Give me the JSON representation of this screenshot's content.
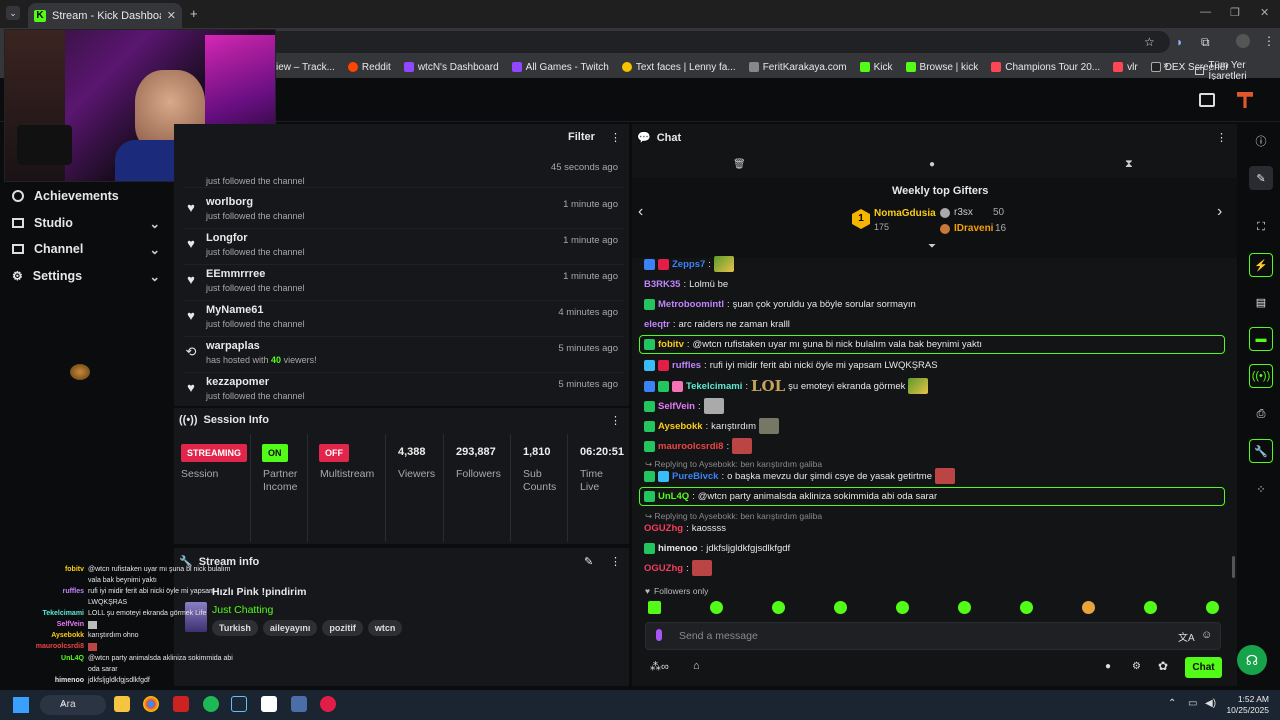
{
  "browser": {
    "tab_title": "Stream - Kick Dashboard",
    "bookmarks": [
      "iew – Track...",
      "Reddit",
      "wtcN's Dashboard",
      "All Games - Twitch",
      "Text faces | Lenny fa...",
      "FeritKarakaya.com",
      "Kick",
      "Browse | kick",
      "Champions Tour 20...",
      "vlr",
      "DEX Screener"
    ],
    "bookmarks_folder": "Tüm Yer İşaretleri"
  },
  "sidebar": {
    "items": [
      {
        "label": "Achievements"
      },
      {
        "label": "Studio"
      },
      {
        "label": "Channel"
      },
      {
        "label": "Settings"
      }
    ]
  },
  "activity": {
    "filter_label": "Filter",
    "rows": [
      {
        "name": "",
        "sub": "just followed the channel",
        "time": "45 seconds ago"
      },
      {
        "name": "worlborg",
        "sub": "just followed the channel",
        "time": "1 minute ago"
      },
      {
        "name": "Longfor",
        "sub": "just followed the channel",
        "time": "1 minute ago"
      },
      {
        "name": "EEmmrrree",
        "sub": "just followed the channel",
        "time": "1 minute ago"
      },
      {
        "name": "MyName61",
        "sub": "just followed the channel",
        "time": "4 minutes ago"
      },
      {
        "name": "warpaplas",
        "sub_prefix": "has hosted with ",
        "viewers": "40",
        "sub_suffix": " viewers!",
        "time": "5 minutes ago"
      },
      {
        "name": "kezzapomer",
        "sub": "just followed the channel",
        "time": "5 minutes ago"
      }
    ]
  },
  "session": {
    "title": "Session Info",
    "streaming_badge": "STREAMING",
    "on_badge": "ON",
    "off_badge": "OFF",
    "session_label": "Session",
    "partner_label": "Partner Income",
    "multistream_label": "Multistream",
    "viewers": "4,388",
    "viewers_label": "Viewers",
    "followers": "293,887",
    "followers_label": "Followers",
    "subs": "1,810",
    "subs_label": "Sub Counts",
    "time": "06:20:51",
    "time_label": "Time Live"
  },
  "stream_info": {
    "title": "Stream info",
    "stream_title": "Hızlı Pink !pindirim",
    "category": "Just Chatting",
    "tags": [
      "Turkish",
      "aileyayını",
      "pozitif",
      "wtcn"
    ]
  },
  "chat": {
    "title": "Chat",
    "gifters_title": "Weekly top Gifters",
    "gifters": [
      {
        "rank": "1",
        "name": "NomaGdusia",
        "amount": "175"
      },
      {
        "rank": "2",
        "name": "r3sx",
        "amount": "50"
      },
      {
        "rank": "3",
        "name": "IDraveni",
        "amount": "16"
      }
    ],
    "messages": [
      {
        "user": "Zepps7",
        "color": "#3b82f6",
        "text": ""
      },
      {
        "user": "B3RK35",
        "color": "#c084fc",
        "text": "Lolmü be"
      },
      {
        "user": "Metroboomintl",
        "color": "#c084fc",
        "text": "şuan çok yoruldu ya böyle sorular sormayın"
      },
      {
        "user": "eleqtr",
        "color": "#c084fc",
        "text": "arc raiders ne zaman kralll"
      },
      {
        "user": "fobitv",
        "color": "#facc15",
        "text": "@wtcn rufistaken uyar mı şuna bi nick bulalım vala bak beynimi yaktı"
      },
      {
        "user": "ruffles",
        "color": "#c084fc",
        "text": "rufi iyi midir ferit abi nicki öyle mi yapsam LWQKŞRAS"
      },
      {
        "user": "Tekelcimami",
        "color": "#5eead4",
        "text": "şu emoteyi ekranda görmek",
        "emote_text": "LOL"
      },
      {
        "user": "SelfVein",
        "color": "#e879f9",
        "text": ""
      },
      {
        "user": "Aysebokk",
        "color": "#facc15",
        "text": "karıştırdım"
      },
      {
        "user": "mauroolcsrdi8",
        "color": "#ef4444",
        "text": ""
      },
      {
        "reply": "Replying to Aysebokk: ben karıştırdım galiba"
      },
      {
        "user": "PureBivck",
        "color": "#3b82f6",
        "text": "o başka mevzu dur şimdi csye de yasak getirtme"
      },
      {
        "user": "UnL4Q",
        "color": "#53fc18",
        "text": "@wtcn party animalsda akliniza sokimmida abi oda sarar"
      },
      {
        "reply": "Replying to Aysebokk: ben karıştırdım galiba"
      },
      {
        "user": "OGUZhg",
        "color": "#f43f5e",
        "text": "kaossss"
      },
      {
        "user": "himenoo",
        "color": "#e6e6e6",
        "text": "jdkfsljgldkfgjsdlkfgdf"
      },
      {
        "user": "OGUZhg",
        "color": "#f43f5e",
        "text": ""
      }
    ],
    "followers_only": "Followers only",
    "input_placeholder": "Send a message",
    "send_label": "Chat"
  },
  "overlay_chat": [
    {
      "user": "fobitv",
      "color": "#facc15",
      "text": "@wtcn rufistaken uyar mı şuna bi nick bulalım"
    },
    {
      "user": "",
      "color": "#e6e6e6",
      "text": "vala bak beynimi yaktı"
    },
    {
      "user": "ruffles",
      "color": "#c084fc",
      "text": "rufi iyi midir ferit abi nicki öyle mi yapsam"
    },
    {
      "user": "",
      "color": "#e6e6e6",
      "text": "LWQKŞRAS"
    },
    {
      "user": "Tekelcimami",
      "color": "#5eead4",
      "text": "LOLL şu emoteyi ekranda görmek Life"
    },
    {
      "user": "SelfVein",
      "color": "#e879f9",
      "text": ""
    },
    {
      "user": "Aysebokk",
      "color": "#facc15",
      "text": "karıştırdım ohno"
    },
    {
      "user": "mauroolcsrdi8",
      "color": "#ef4444",
      "text": ""
    },
    {
      "user": "UnL4Q",
      "color": "#53fc18",
      "text": "@wtcn party animalsda akliniza sokimmida abi"
    },
    {
      "user": "",
      "color": "#e6e6e6",
      "text": "oda sarar"
    },
    {
      "user": "himenoo",
      "color": "#e6e6e6",
      "text": "jdkfsljgldkfgjsdlkfgdf"
    }
  ],
  "taskbar": {
    "search_label": "Ara",
    "time": "1:52 AM",
    "date": "10/25/2025"
  },
  "colors": {
    "accent": "#53fc18",
    "bg": "#0b0c0e",
    "panel": "#16171a",
    "streaming": "#e2254a"
  }
}
